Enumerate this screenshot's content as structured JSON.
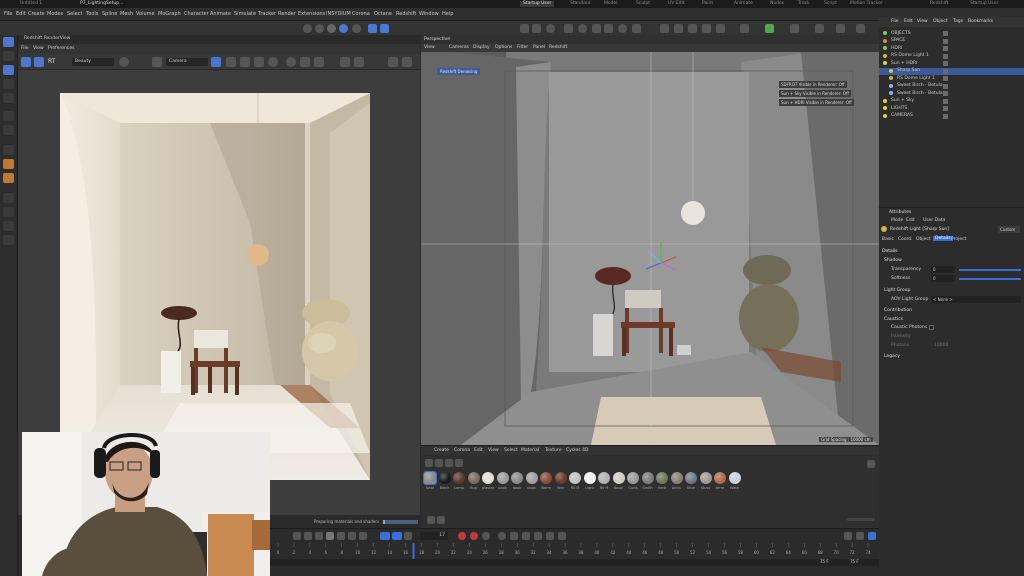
{
  "window": {
    "tabs": [
      "Untitled 1",
      "P7_LightingSetup...",
      "Startup User"
    ],
    "top_modes": [
      "Standard",
      "Model",
      "Sculpt",
      "UV Edit",
      "Paint",
      "Animate",
      "Nodes",
      "Track",
      "Script",
      "Motion Tracker",
      "Redshift",
      "Startup User"
    ]
  },
  "menubar": {
    "items": [
      "File",
      "Edit",
      "Create",
      "Modes",
      "Select",
      "Tools",
      "Spline",
      "Mesh",
      "Volume",
      "MoGraph",
      "Character",
      "Animate",
      "Simulate",
      "Tracker",
      "Render",
      "Extensions",
      "INSYDIUM",
      "Corona",
      "Octane",
      "Redshift",
      "Window",
      "Help"
    ]
  },
  "render_view": {
    "title": "Redshift RenderView",
    "menu": [
      "File",
      "View",
      "Preferences"
    ],
    "rt_label": "RT",
    "beauty": "Beauty",
    "camera": "Camera"
  },
  "viewport": {
    "label": "Perspective",
    "menu": [
      "View",
      "Cameras",
      "Display",
      "Options",
      "Filter",
      "Panel",
      "Redshift"
    ],
    "denoise_badge": "Redshift Denoising",
    "status_lines": [
      "SDFROT Visible in Renderer: Off",
      "Sun + Sky Visible in Renderer: Off",
      "Sun + HDRI Visible in Renderer: Off"
    ],
    "grid_spacing": "Grid Spacing : 10000 cm"
  },
  "object_manager": {
    "menu": [
      "File",
      "Edit",
      "View",
      "Object",
      "Tags",
      "Bookmarks"
    ],
    "objects": [
      {
        "name": "OBJECTS",
        "color": "#7fcf5a",
        "indent": 0
      },
      {
        "name": "SPACE",
        "color": "#d98a3a",
        "indent": 0
      },
      {
        "name": "HDRI",
        "color": "#7fcf5a",
        "indent": 0
      },
      {
        "name": "RS Dome Light 1",
        "color": "#d9b23a",
        "indent": 0
      },
      {
        "name": "Sun + HDRI",
        "color": "#d9d23a",
        "indent": 0
      },
      {
        "name": "Sharp Sun",
        "color": "#e0c040",
        "indent": 1
      },
      {
        "name": "RS Dome Light 1",
        "color": "#d9b23a",
        "indent": 1
      },
      {
        "name": "Sweet Birch - Betula",
        "color": "#8fb0ff",
        "indent": 1
      },
      {
        "name": "Sweet Birch - Betula",
        "color": "#8fb0ff",
        "indent": 1
      },
      {
        "name": "Sun + Sky",
        "color": "#d9d23a",
        "indent": 0
      },
      {
        "name": "LIGHTS",
        "color": "#d9d23a",
        "indent": 0
      },
      {
        "name": "CAMERAS",
        "color": "#d9d23a",
        "indent": 0
      }
    ]
  },
  "attributes": {
    "title": "Attributes",
    "menu": [
      "Mode",
      "Edit",
      "User Data"
    ],
    "object_name": "Redshift Light [Sharp Sun]",
    "custom": "Custom",
    "tabs": [
      "Basic",
      "Coord.",
      "Object",
      "Details",
      "Project"
    ],
    "active_tab": "Details",
    "section": "Details",
    "groups": [
      "Shadow",
      "Light Group",
      "Contribution",
      "Caustics",
      "Legacy"
    ],
    "shadow_transparency_label": "Transparency",
    "shadow_transparency": "0",
    "shadow_softness_label": "Softness",
    "shadow_softness": "0",
    "aov_label": "AOV Light Group",
    "aov_value": "< None >",
    "caustic_label": "Caustic Photons",
    "intensity_label": "Intensity",
    "photons_label": "Photons",
    "photons_value": "10000"
  },
  "materials": {
    "menu": [
      "Create",
      "Corona",
      "Edit",
      "View",
      "Select",
      "Material",
      "Texture",
      "Cycles 4D"
    ],
    "items": [
      {
        "name": "Swat",
        "color": "#8a8a8a"
      },
      {
        "name": "Black",
        "color": "#1a1a1a"
      },
      {
        "name": "Lamp",
        "color": "#5a3a2a"
      },
      {
        "name": "Rug",
        "color": "#7a6a5a"
      },
      {
        "name": "plaster",
        "color": "#e0ddd5"
      },
      {
        "name": "book",
        "color": "#9a9a9a"
      },
      {
        "name": "book",
        "color": "#8a8a8a"
      },
      {
        "name": "book",
        "color": "#a0a0a0"
      },
      {
        "name": "Warm",
        "color": "#8a4a3a"
      },
      {
        "name": "Vein",
        "color": "#6a3a2a"
      },
      {
        "name": "RS M",
        "color": "#c0c0c0"
      },
      {
        "name": "Light",
        "color": "#f0f0f0"
      },
      {
        "name": "RS M",
        "color": "#b0b0b0"
      },
      {
        "name": "Boucl",
        "color": "#d0ccc4"
      },
      {
        "name": "Curts",
        "color": "#9a9a9a"
      },
      {
        "name": "Smith",
        "color": "#7a7a7a"
      },
      {
        "name": "Herb",
        "color": "#6a7a5a"
      },
      {
        "name": "Antiu",
        "color": "#8a8070"
      },
      {
        "name": "Blue",
        "color": "#6a7a8a"
      },
      {
        "name": "Stuss",
        "color": "#a09a90"
      },
      {
        "name": "terre",
        "color": "#b06a4a"
      },
      {
        "name": "Wate",
        "color": "#c8d0d8"
      }
    ]
  },
  "progress": {
    "text": "Preparing materials and shaders",
    "value": 0.05
  },
  "timeline": {
    "ticks": [
      "0",
      "2",
      "4",
      "6",
      "8",
      "10",
      "12",
      "14",
      "16",
      "18",
      "20",
      "22",
      "24",
      "26",
      "28",
      "30",
      "32",
      "34",
      "36",
      "38",
      "40",
      "42",
      "44",
      "46",
      "48",
      "50",
      "52",
      "54",
      "56",
      "58",
      "60",
      "62",
      "64",
      "66",
      "68",
      "70",
      "72",
      "74"
    ],
    "current_frame": "17",
    "end_frame": "75 F",
    "end_frame2": "75 F"
  },
  "colors": {
    "accent": "#3a6fd8",
    "panel": "#2c2c2c",
    "render_bg": "#3d3d3d"
  }
}
